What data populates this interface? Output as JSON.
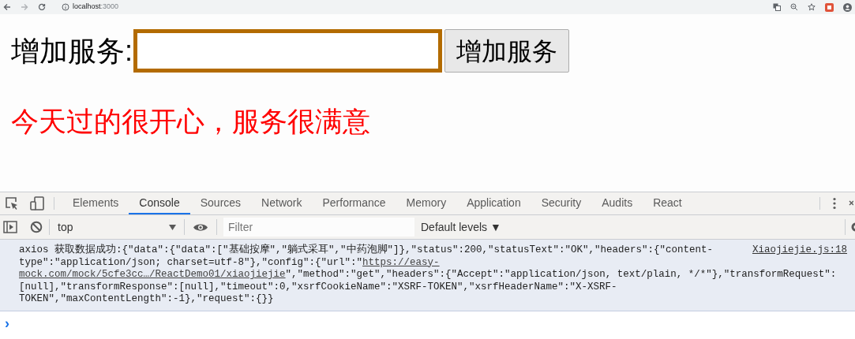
{
  "browser": {
    "url_host": "localhost",
    "url_port": ":3000"
  },
  "page": {
    "label": "增加服务:",
    "button": "增加服务",
    "items": [
      {
        "text": "今天过的很开心，服务很满意"
      }
    ]
  },
  "devtools": {
    "tabs": [
      {
        "label": "Elements",
        "selected": false
      },
      {
        "label": "Console",
        "selected": true
      },
      {
        "label": "Sources",
        "selected": false
      },
      {
        "label": "Network",
        "selected": false
      },
      {
        "label": "Performance",
        "selected": false
      },
      {
        "label": "Memory",
        "selected": false
      },
      {
        "label": "Application",
        "selected": false
      },
      {
        "label": "Security",
        "selected": false
      },
      {
        "label": "Audits",
        "selected": false
      },
      {
        "label": "React",
        "selected": false
      }
    ],
    "context": "top",
    "filter_placeholder": "Filter",
    "levels": "Default levels ▼",
    "log": {
      "source": "Xiaojiejie.js:18",
      "lines": [
        [
          {
            "text": "axios 获取数据成功:{\"data\":{\"data\":[\"基础按摩\",\"躺式采耳\",\"中药泡脚\"]},\"status\":200,\"statusText\":\"OK\",\"headers\":{\"content-",
            "link": false
          }
        ],
        [
          {
            "text": "type\":\"application/json; charset=utf-8\"},\"config\":{\"url\":\"",
            "link": false
          },
          {
            "text": "https://easy-",
            "link": true
          }
        ],
        [
          {
            "text": "mock.com/mock/5cfe3cc…/ReactDemo01/xiaojiejie",
            "link": true
          },
          {
            "text": "\",\"method\":\"get\",\"headers\":{\"Accept\":\"application/json, text/plain, */*\"},\"transformRequest\":",
            "link": false
          }
        ],
        [
          {
            "text": "[null],\"transformResponse\":[null],\"timeout\":0,\"xsrfCookieName\":\"XSRF-TOKEN\",\"xsrfHeaderName\":\"X-XSRF-",
            "link": false
          }
        ],
        [
          {
            "text": "TOKEN\",\"maxContentLength\":-1},\"request\":{}}",
            "link": false
          }
        ]
      ]
    },
    "prompt": "›"
  }
}
